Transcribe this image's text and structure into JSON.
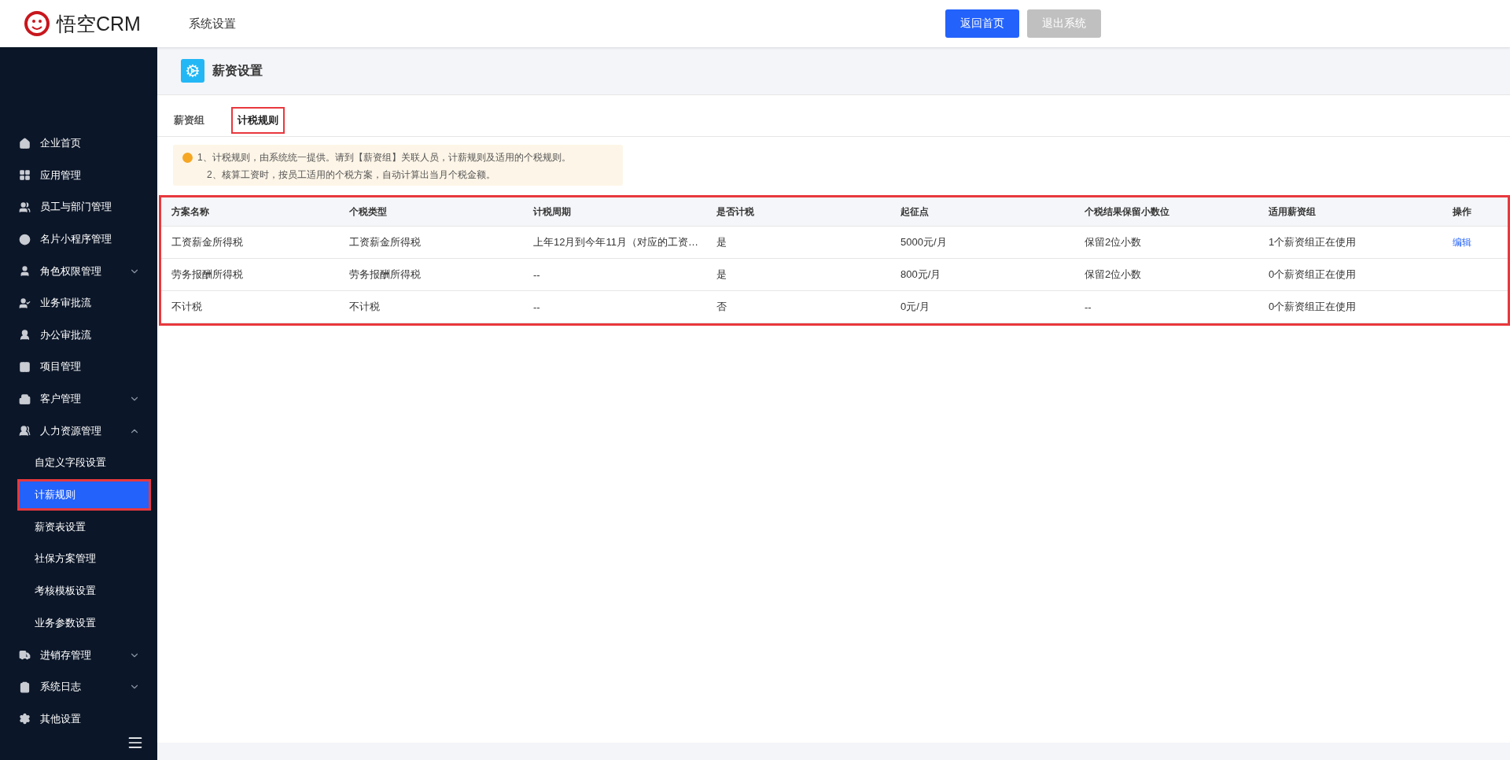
{
  "header": {
    "logo_text": "悟空CRM",
    "title": "系统设置",
    "buttons": [
      {
        "label": "返回首页",
        "kind": "primary"
      },
      {
        "label": "退出系统",
        "kind": "disabled"
      }
    ]
  },
  "sidebar": {
    "items": [
      {
        "label": "企业首页"
      },
      {
        "label": "应用管理"
      },
      {
        "label": "员工与部门管理"
      },
      {
        "label": "名片小程序管理"
      },
      {
        "label": "角色权限管理",
        "expanded": false
      },
      {
        "label": "业务审批流"
      },
      {
        "label": "办公审批流"
      },
      {
        "label": "项目管理"
      },
      {
        "label": "客户管理",
        "expanded": false
      },
      {
        "label": "人力资源管理",
        "expanded": true,
        "children": [
          {
            "label": "自定义字段设置",
            "selected": false,
            "highlighted": false
          },
          {
            "label": "计薪规则",
            "selected": true,
            "highlighted": true
          },
          {
            "label": "薪资表设置",
            "selected": false,
            "highlighted": false
          },
          {
            "label": "社保方案管理",
            "selected": false,
            "highlighted": false
          },
          {
            "label": "考核模板设置",
            "selected": false,
            "highlighted": false
          },
          {
            "label": "业务参数设置",
            "selected": false,
            "highlighted": false
          }
        ]
      },
      {
        "label": "进销存管理",
        "expanded": false
      },
      {
        "label": "系统日志",
        "expanded": false
      },
      {
        "label": "其他设置"
      }
    ]
  },
  "page": {
    "title": "薪资设置",
    "tabs": [
      {
        "label": "薪资组",
        "selected": false,
        "highlighted": false
      },
      {
        "label": "计税规则",
        "selected": true,
        "highlighted": true
      }
    ],
    "notice": [
      "1、计税规则，由系统统一提供。请到【薪资组】关联人员，计薪规则及适用的个税规则。",
      "2、核算工资时，按员工适用的个税方案，自动计算出当月个税金额。"
    ],
    "table": {
      "highlighted": true,
      "columns": [
        "方案名称",
        "个税类型",
        "计税周期",
        "是否计税",
        "起征点",
        "个税结果保留小数位",
        "适用薪资组",
        "操作"
      ],
      "rows": [
        {
          "cells": [
            "工资薪金所得税",
            "工资薪金所得税",
            "上年12月到今年11月（对应的工资…",
            "是",
            "5000元/月",
            "保留2位小数",
            "1个薪资组正在使用"
          ],
          "action": "编辑"
        },
        {
          "cells": [
            "劳务报酬所得税",
            "劳务报酬所得税",
            "--",
            "是",
            "800元/月",
            "保留2位小数",
            "0个薪资组正在使用"
          ]
        },
        {
          "cells": [
            "不计税",
            "不计税",
            "--",
            "否",
            "0元/月",
            "--",
            "0个薪资组正在使用"
          ]
        }
      ]
    }
  }
}
